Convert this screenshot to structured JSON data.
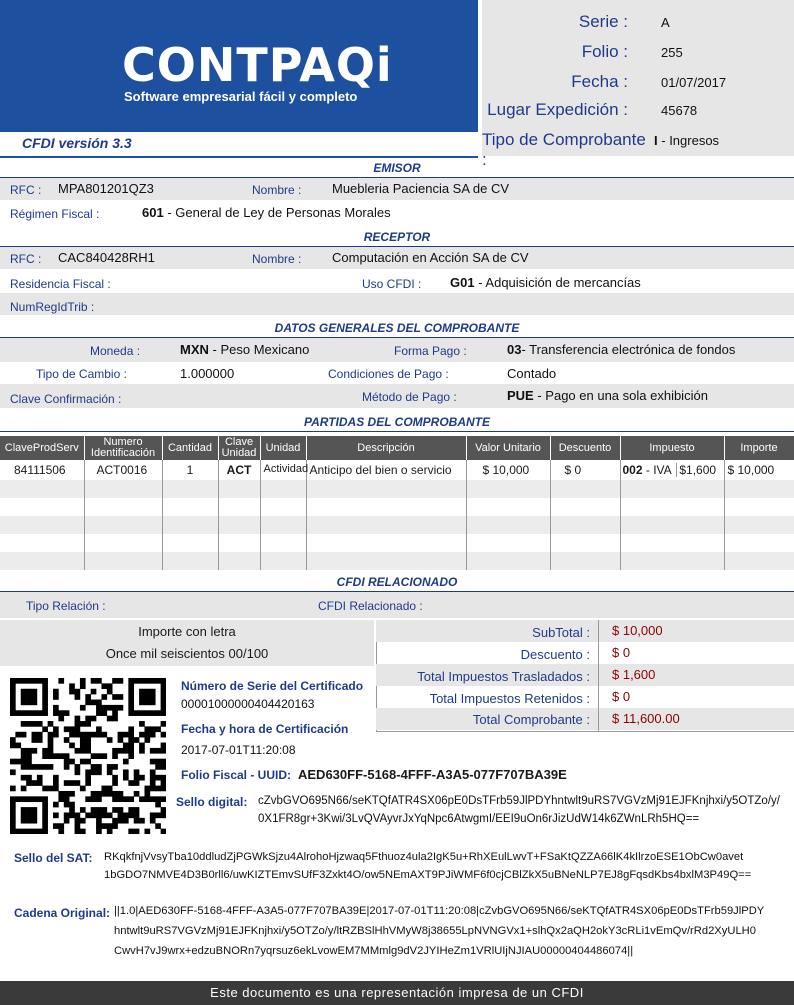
{
  "logo": {
    "brand": "CONTPAQi",
    "tagline": "Software empresarial fácil y completo"
  },
  "cfdi_version": "CFDI versión 3.3",
  "header": {
    "serie_label": "Serie :",
    "serie": "A",
    "folio_label": "Folio :",
    "folio": "255",
    "fecha_label": "Fecha :",
    "fecha": "01/07/2017",
    "lugar_label": "Lugar Expedición :",
    "lugar": "45678",
    "tipo_label": "Tipo de Comprobante :",
    "tipo_code": "I",
    "tipo_desc": "- Ingresos"
  },
  "emisor": {
    "title": "EMISOR",
    "rfc_label": "RFC :",
    "rfc": "MPA801201QZ3",
    "nombre_label": "Nombre :",
    "nombre": "Muebleria Paciencia SA de CV",
    "regimen_label": "Régimen Fiscal :",
    "regimen_code": "601",
    "regimen_desc": "- General de Ley de Personas Morales"
  },
  "receptor": {
    "title": "RECEPTOR",
    "rfc_label": "RFC :",
    "rfc": "CAC840428RH1",
    "nombre_label": "Nombre :",
    "nombre": "Computación en Acción SA de CV",
    "residencia_label": "Residencia Fiscal :",
    "uso_label": "Uso CFDI :",
    "uso_code": "G01",
    "uso_desc": "- Adquisición de mercancías",
    "numreg_label": "NumRegIdTrib :"
  },
  "datos": {
    "title": "DATOS GENERALES DEL COMPROBANTE",
    "moneda_label": "Moneda :",
    "moneda_code": "MXN",
    "moneda_desc": "- Peso Mexicano",
    "forma_label": "Forma Pago :",
    "forma_code": "03",
    "forma_desc": "- Transferencia electrónica de fondos",
    "tipocambio_label": "Tipo de Cambio :",
    "tipocambio": "1.000000",
    "condiciones_label": "Condiciones de Pago :",
    "condiciones": "Contado",
    "clave_label": "Clave Confirmación :",
    "metodo_label": "Método de Pago :",
    "metodo_code": "PUE",
    "metodo_desc": "- Pago en una sola exhibición"
  },
  "partidas": {
    "title": "PARTIDAS DEL COMPROBANTE",
    "headers": [
      "ClaveProdServ",
      "Numero Identificación",
      "Cantidad",
      "Clave Unidad",
      "Unidad",
      "Descripción",
      "Valor Unitario",
      "Descuento",
      "Impuesto",
      "Importe"
    ],
    "row": {
      "clave": "84111506",
      "num": "ACT0016",
      "cant": "1",
      "clave_unidad": "ACT",
      "unidad": "Actividad",
      "desc": "Anticipo del bien o servicio",
      "valor": "$ 10,000",
      "descuento": "$ 0",
      "imp_code": "002",
      "imp_desc": "- IVA",
      "imp_val": "$1,600",
      "importe": "$ 10,000"
    }
  },
  "relacionado": {
    "title": "CFDI RELACIONADO",
    "tipo_label": "Tipo Relación :",
    "cfdi_label": "CFDI Relacionado :"
  },
  "importe_letra": {
    "label": "Importe con letra",
    "value": "Once mil seiscientos 00/100"
  },
  "totales": {
    "subtotal_label": "SubTotal :",
    "subtotal": "$ 10,000",
    "descuento_label": "Descuento :",
    "descuento": "$ 0",
    "trasladados_label": "Total Impuestos Trasladados :",
    "trasladados": "$ 1,600",
    "retenidos_label": "Total Impuestos Retenidos :",
    "retenidos": "$ 0",
    "total_label": "Total Comprobante :",
    "total": "$ 11,600.00"
  },
  "certificado": {
    "serie_label": "Número de Serie del Certificado",
    "serie": "00001000000404420163",
    "fecha_label": "Fecha y hora de Certificación",
    "fecha": "2017-07-01T11:20:08",
    "uuid_label": "Folio Fiscal - UUID:",
    "uuid": "AED630FF-5168-4FFF-A3A5-077F707BA39E",
    "sello_label": "Sello digital:",
    "sello_l1": "cZvbGVO695N66/seKTQfATR4SX06pE0DsTFrb59JlPDYhntwlt9uRS7VGVzMj91EJFKnjhxi/y5OTZo/y/",
    "sello_l2": "0X1FR8gr+3Kwi/3LvQVAyvrJxYqNpc6AtwgmI/EEI9uOn6rJizUdW14k6ZWnLRh5HQ=="
  },
  "sello_sat": {
    "label": "Sello del SAT:",
    "l1": "RKqkfnjVvsyTba10ddludZjPGWkSjzu4AlrohoHjzwaq5Fthuoz4ula2IgK5u+RhXEulLwvT+FSaKtQZZA66lK4kIlrzoESE1ObCw0avet",
    "l2": "1bGDO7NMVE4D3B0rll6/uwKIZTEmvSUfF3Zxkt4O/ow5NEmAXT9PJiWMF6f0cjCBlZkX5uBNeNLP7EJ8gFqsdKbs4bxlM3P49Q=="
  },
  "cadena": {
    "label": "Cadena Original:",
    "l1": "||1.0|AED630FF-5168-4FFF-A3A5-077F707BA39E|2017-07-01T11:20:08|cZvbGVO695N66/seKTQfATR4SX06pE0DsTFrb59JlPDY",
    "l2": "hntwlt9uRS7VGVzMj91EJFKnjhxi/y5OTZo/y/ltRZBSlHhVMyW8j38655LpNVNGVx1+slhQx2aQH2okY3cRLi1vEmQv/rRd2XyULH0",
    "l3": "CwvH7vJ9wrx+edzuBNORn7yqrsuz6ekLvowEM7MMmlg9dV2JYIHeZm1VRlUIjNJIAU00000404486074||"
  },
  "footer": "Este documento es una representación impresa de un CFDI"
}
